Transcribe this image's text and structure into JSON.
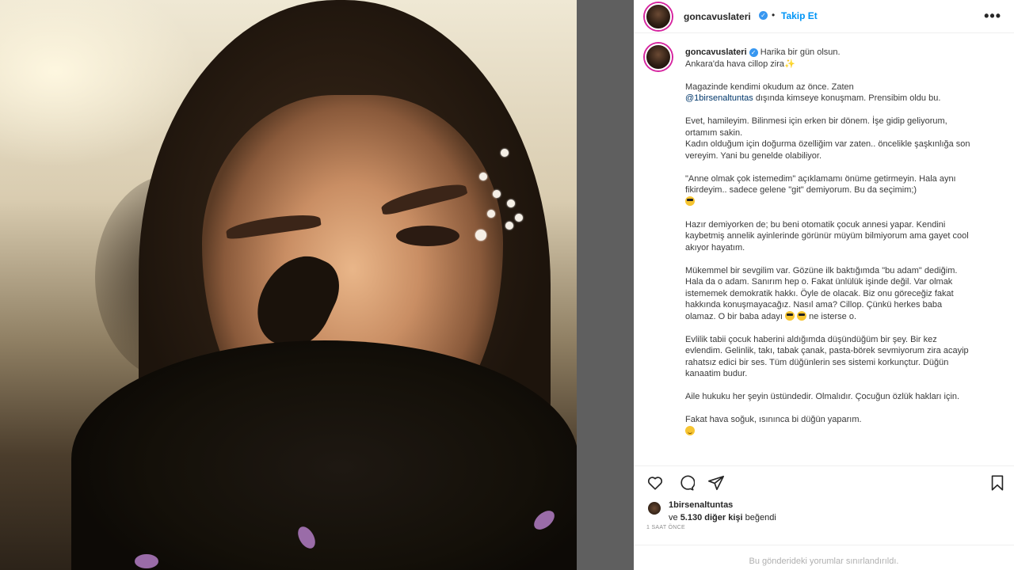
{
  "header": {
    "username": "goncavuslateri",
    "dot": "•",
    "follow_label": "Takip Et",
    "more_icon": "more-horizontal-icon"
  },
  "caption": {
    "username": "goncavuslateri",
    "p1_line1": "Harika bir gün olsun.",
    "p1_line2": "Ankara'da hava cillop zira",
    "p2_pre": "Magazinde kendimi okudum az önce. Zaten",
    "p2_mention": "@1birsenaltuntas",
    "p2_post": "dışında kimseye konuşmam. Prensibim oldu bu.",
    "p3": "Evet, hamileyim. Bilinmesi için erken bir dönem. İşe gidip geliyorum, ortamım sakin.",
    "p3b": "Kadın olduğum için doğurma özelliğim var zaten.. öncelikle şaşkınlığa son vereyim. Yani bu genelde olabiliyor.",
    "p4": "\"Anne olmak çok istemedim\" açıklamamı önüme getirmeyin. Hala aynı fikirdeyim.. sadece gelene \"git\" demiyorum. Bu da seçimim;)",
    "p5": "Hazır demiyorken de; bu beni otomatik çocuk annesi yapar. Kendini kaybetmiş annelik ayinlerinde görünür müyüm bilmiyorum ama gayet cool akıyor hayatım.",
    "p6": "Mükemmel bir sevgilim var. Gözüne ilk baktığımda \"bu adam\" dediğim. Hala da o adam. Sanırım hep o. Fakat ünlülük işinde değil. Var olmak istememek demokratik hakkı. Öyle de olacak. Biz onu göreceğiz fakat hakkında konuşmayacağız. Nasıl ama? Cillop. Çünkü herkes baba olamaz. O bir baba adayı",
    "p6_end": "ne isterse o.",
    "p7": "Evlilik tabii çocuk haberini aldığımda düşündüğüm bir şey. Bir kez evlendim. Gelinlik, takı, tabak çanak, pasta-börek sevmiyorum zira acayip rahatsız edici bir ses. Tüm düğünlerin ses sistemi korkunçtur. Düğün kanaatim budur.",
    "p8": "Aile hukuku her şeyin üstündedir. Olmalıdır. Çocuğun özlük hakları için.",
    "p9": "Fakat hava soğuk, ısınınca bi düğün yaparım."
  },
  "actions": {
    "like_icon": "heart-icon",
    "comment_icon": "comment-icon",
    "share_icon": "share-icon",
    "save_icon": "bookmark-icon"
  },
  "likes": {
    "liker": "1birsenaltuntas",
    "prefix": "ve",
    "count_text": "5.130 diğer kişi",
    "suffix": "beğendi"
  },
  "time": "1 SAAT ÖNCE",
  "comments_limited": "Bu gönderideki yorumlar sınırlandırıldı.",
  "colors": {
    "accent": "#0095f6",
    "verified": "#3897f0",
    "mention": "#00376b"
  }
}
